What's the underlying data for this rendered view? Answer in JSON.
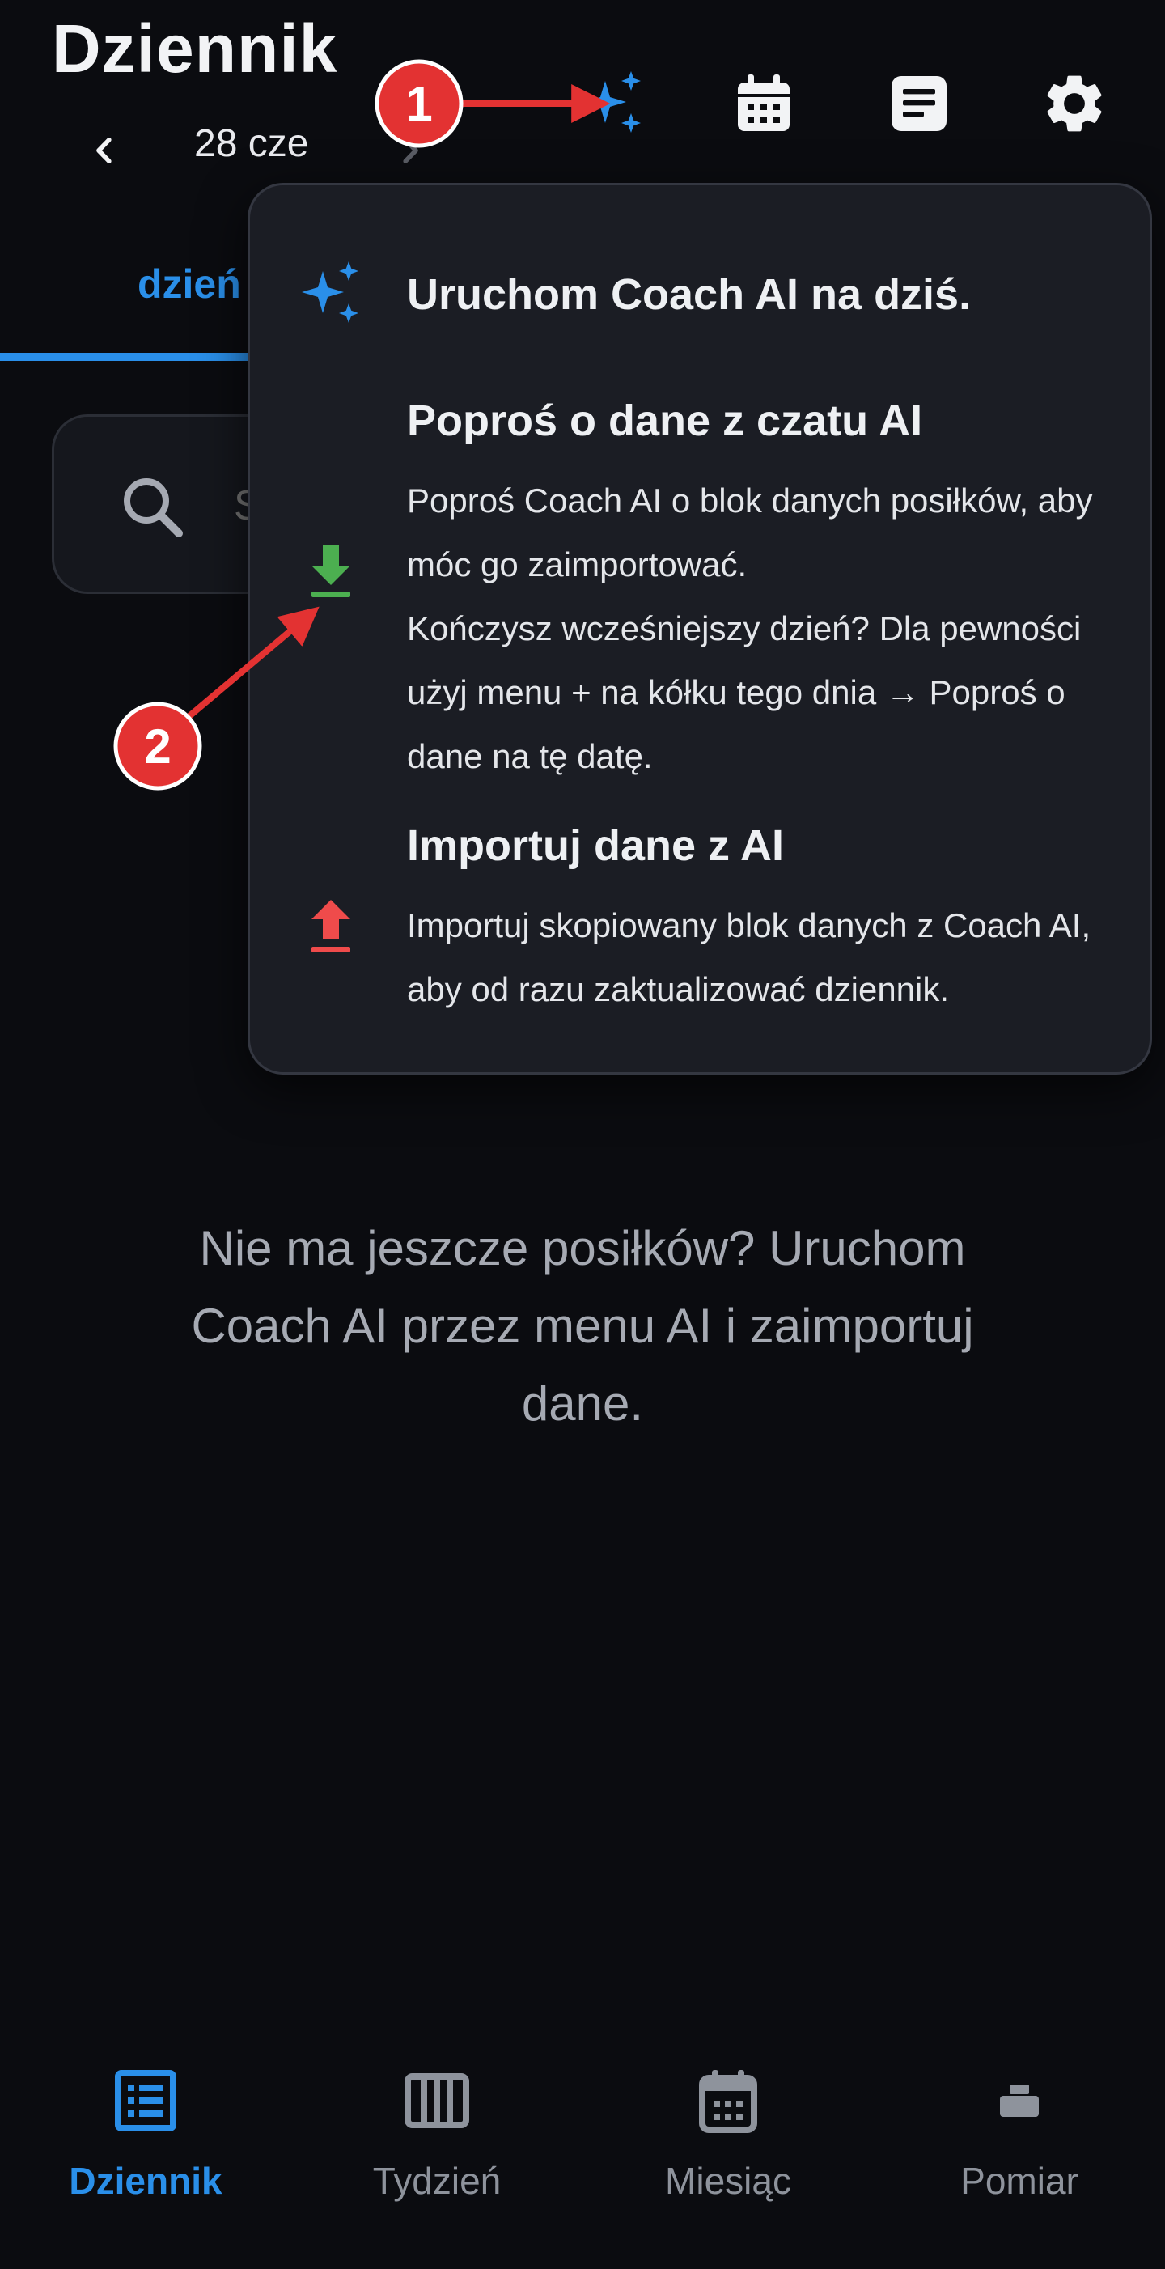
{
  "header": {
    "title": "Dziennik",
    "date": "28 cze"
  },
  "tabs": {
    "active_label": "dzień"
  },
  "search": {
    "placeholder": "S"
  },
  "empty_state": {
    "text": "Nie ma jeszcze posiłków? Uruchom Coach AI przez menu AI i zaimportuj dane."
  },
  "ai_menu": {
    "items": [
      {
        "title": "Uruchom Coach AI na dziś.",
        "icon": "sparkles-icon"
      },
      {
        "title": "Poproś o dane z czatu AI",
        "description_1": "Poproś Coach AI o blok danych posiłków, aby móc go zaimportować.",
        "description_2": "Kończysz wcześniejszy dzień? Dla pewności użyj menu + na kółku tego dnia → Poproś o dane na tę datę.",
        "icon": "download-icon"
      },
      {
        "title": "Importuj dane z AI",
        "description_1": "Importuj skopiowany blok danych z Coach AI, aby od razu zaktualizować dziennik.",
        "icon": "upload-icon"
      }
    ]
  },
  "bottom_nav": {
    "items": [
      {
        "label": "Dziennik",
        "icon": "list-icon",
        "active": true
      },
      {
        "label": "Tydzień",
        "icon": "week-icon",
        "active": false
      },
      {
        "label": "Miesiąc",
        "icon": "calendar-icon",
        "active": false
      },
      {
        "label": "Pomiar",
        "icon": "scale-icon",
        "active": false
      }
    ]
  },
  "annotations": {
    "marker_1": "1",
    "marker_2": "2"
  },
  "colors": {
    "accent": "#2a8fe9",
    "download": "#4caf50",
    "upload": "#ef4b4b",
    "annotation": "#e33232",
    "background": "#0b0c10",
    "popup": "#1b1d24"
  }
}
